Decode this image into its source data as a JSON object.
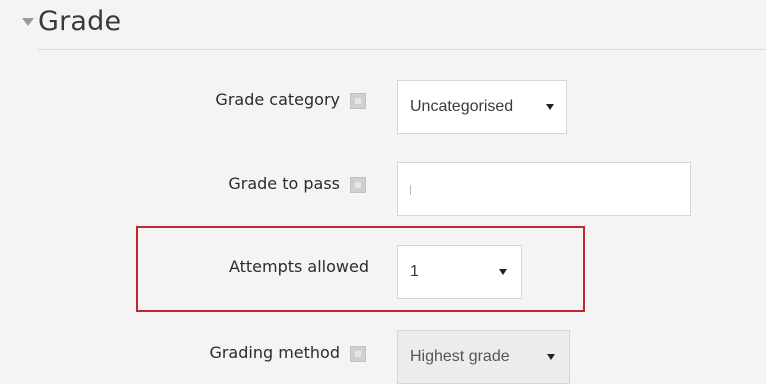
{
  "section": {
    "title": "Grade"
  },
  "fields": {
    "grade_category": {
      "label": "Grade category",
      "value": "Uncategorised"
    },
    "grade_to_pass": {
      "label": "Grade to pass",
      "value": ""
    },
    "attempts_allowed": {
      "label": "Attempts allowed",
      "value": "1"
    },
    "grading_method": {
      "label": "Grading method",
      "value": "Highest grade"
    }
  },
  "colors": {
    "background": "#f4f4f4",
    "highlight": "#c0282d"
  },
  "icons": {
    "collapse": "caret-down-icon",
    "help": "help-icon",
    "dropdown": "dropdown-arrow-icon"
  }
}
